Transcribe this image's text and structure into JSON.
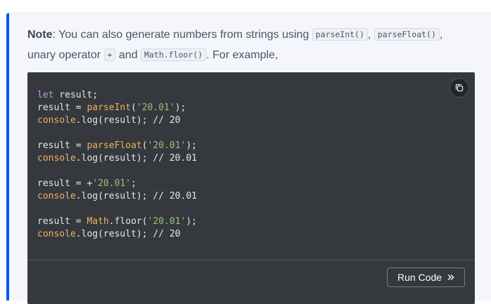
{
  "note": {
    "label": "Note",
    "text_1": ": You can also generate numbers from strings using ",
    "code_1": "parseInt()",
    "sep_1": ", ",
    "code_2": "parseFloat()",
    "sep_2": ",",
    "text_2": "unary operator ",
    "code_3": "+",
    "text_3": " and ",
    "code_4": "Math.floor()",
    "text_4": ". For example,"
  },
  "code_block": {
    "lines": [
      [
        {
          "t": "kw",
          "v": "let"
        },
        {
          "t": "p",
          "v": " result;"
        }
      ],
      [
        {
          "t": "p",
          "v": "result = "
        },
        {
          "t": "fn",
          "v": "parseInt"
        },
        {
          "t": "p",
          "v": "("
        },
        {
          "t": "str",
          "v": "'20.01'"
        },
        {
          "t": "p",
          "v": ");"
        }
      ],
      [
        {
          "t": "fn",
          "v": "console"
        },
        {
          "t": "p",
          "v": ".log(result); "
        },
        {
          "t": "cm",
          "v": "// 20"
        }
      ],
      [],
      [
        {
          "t": "p",
          "v": "result = "
        },
        {
          "t": "fn",
          "v": "parseFloat"
        },
        {
          "t": "p",
          "v": "("
        },
        {
          "t": "str",
          "v": "'20.01'"
        },
        {
          "t": "p",
          "v": ");"
        }
      ],
      [
        {
          "t": "fn",
          "v": "console"
        },
        {
          "t": "p",
          "v": ".log(result); "
        },
        {
          "t": "cm",
          "v": "// 20.01"
        }
      ],
      [],
      [
        {
          "t": "p",
          "v": "result = +"
        },
        {
          "t": "str",
          "v": "'20.01'"
        },
        {
          "t": "p",
          "v": ";"
        }
      ],
      [
        {
          "t": "fn",
          "v": "console"
        },
        {
          "t": "p",
          "v": ".log(result); "
        },
        {
          "t": "cm",
          "v": "// 20.01"
        }
      ],
      [],
      [
        {
          "t": "p",
          "v": "result = "
        },
        {
          "t": "fn",
          "v": "Math"
        },
        {
          "t": "p",
          "v": ".floor("
        },
        {
          "t": "str",
          "v": "'20.01'"
        },
        {
          "t": "p",
          "v": ");"
        }
      ],
      [
        {
          "t": "fn",
          "v": "console"
        },
        {
          "t": "p",
          "v": ".log(result); "
        },
        {
          "t": "cm",
          "v": "// 20"
        }
      ]
    ],
    "copy_icon": "copy-icon",
    "run_label": "Run Code",
    "run_icon": "double-chevron-right-icon"
  },
  "colors": {
    "accent": "#0556f3",
    "note_bg": "#f5f6fb",
    "code_bg": "#35383d",
    "keyword": "#c792ea",
    "function": "#f0b15d",
    "string": "#98c379"
  }
}
